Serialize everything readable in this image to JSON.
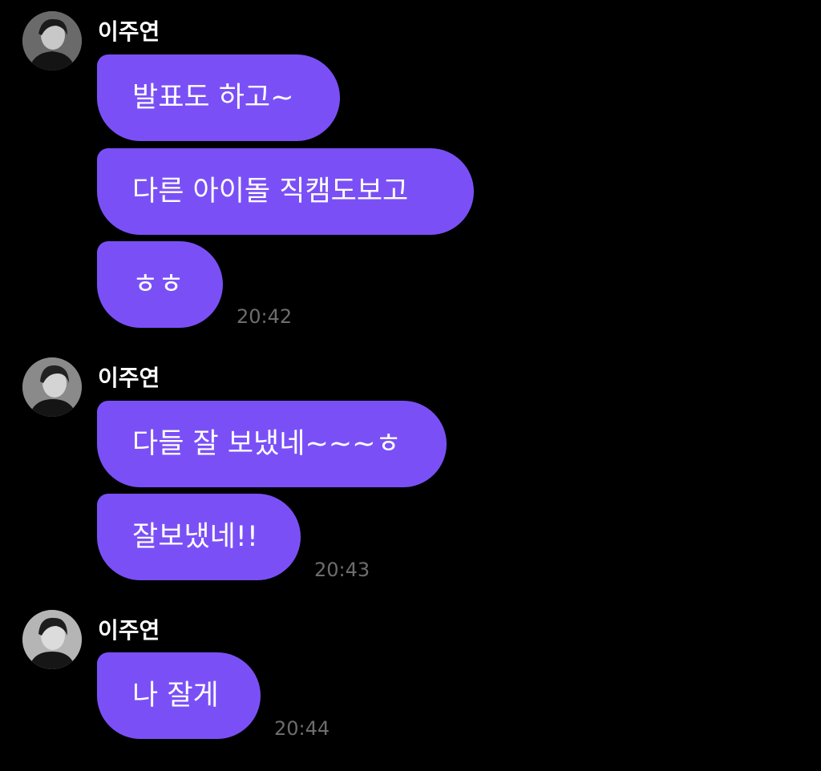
{
  "colors": {
    "background": "#000000",
    "bubble": "#7a50f6",
    "bubble_text": "#ffffff",
    "sender_text": "#ffffff",
    "timestamp": "#6d6d6d"
  },
  "groups": [
    {
      "sender": "이주연",
      "avatar_icon": "profile-photo",
      "messages": [
        "발표도 하고~",
        "다른 아이돌 직캠도보고",
        "ㅎㅎ"
      ],
      "time": "20:42"
    },
    {
      "sender": "이주연",
      "avatar_icon": "profile-photo",
      "messages": [
        "다들 잘 보냈네~~~ㅎ",
        "잘보냈네!!"
      ],
      "time": "20:43"
    },
    {
      "sender": "이주연",
      "avatar_icon": "profile-photo",
      "messages": [
        "나 잘게"
      ],
      "time": "20:44"
    }
  ]
}
